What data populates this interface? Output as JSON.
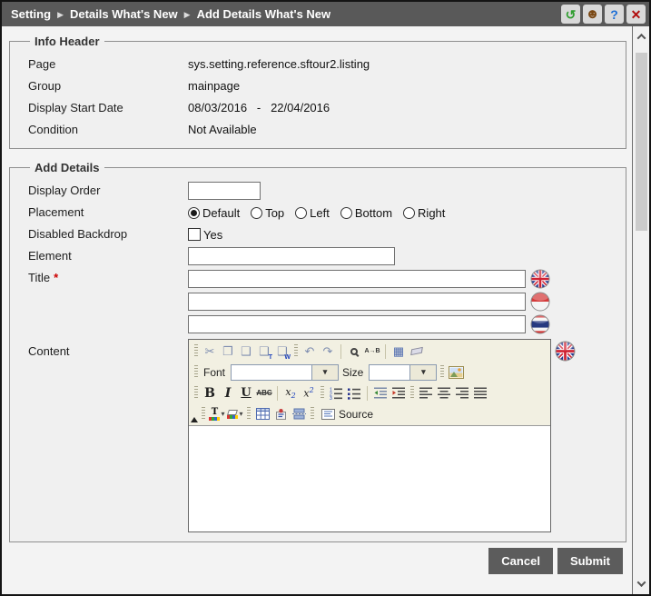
{
  "breadcrumb": {
    "items": [
      "Setting",
      "Details What's New",
      "Add Details What's New"
    ],
    "separator": "▶"
  },
  "titlebar_icons": {
    "refresh_glyph": "↺",
    "session_glyph": "☻",
    "help_glyph": "?",
    "close_glyph": "✕"
  },
  "info_header": {
    "legend": "Info Header",
    "fields": [
      {
        "label": "Page",
        "value": "sys.setting.reference.sftour2.listing"
      },
      {
        "label": "Group",
        "value": "mainpage"
      },
      {
        "label": "Display Start Date",
        "value": "08/03/2016   -   22/04/2016"
      },
      {
        "label": "Condition",
        "value": "Not Available"
      }
    ]
  },
  "add_details": {
    "legend": "Add Details",
    "display_order": {
      "label": "Display Order",
      "value": ""
    },
    "placement": {
      "label": "Placement",
      "options": [
        {
          "label": "Default",
          "selected": true
        },
        {
          "label": "Top",
          "selected": false
        },
        {
          "label": "Left",
          "selected": false
        },
        {
          "label": "Bottom",
          "selected": false
        },
        {
          "label": "Right",
          "selected": false
        }
      ]
    },
    "disabled_backdrop": {
      "label": "Disabled Backdrop",
      "option_label": "Yes",
      "checked": false
    },
    "element": {
      "label": "Element",
      "value": ""
    },
    "title": {
      "label": "Title",
      "required_marker": "*",
      "inputs": [
        {
          "language": "english",
          "flag": "uk",
          "value": ""
        },
        {
          "language": "indonesian",
          "flag": "indonesia",
          "value": ""
        },
        {
          "language": "thai",
          "flag": "thailand",
          "value": ""
        }
      ]
    },
    "content": {
      "label": "Content",
      "language": "english",
      "editor": {
        "font_label": "Font",
        "font_value": "",
        "size_label": "Size",
        "size_value": "",
        "source_label": "Source",
        "body_text": "",
        "toolbar_icons_row1": [
          "cut",
          "copy",
          "paste",
          "paste-plain-text",
          "paste-from-word",
          "undo",
          "redo",
          "find",
          "replace",
          "select-all",
          "remove-format"
        ],
        "toolbar_icons_row2": [
          "font-dropdown",
          "size-dropdown",
          "insert-image"
        ],
        "toolbar_icons_row3": [
          "bold",
          "italic",
          "underline",
          "strikethrough",
          "subscript",
          "superscript",
          "numbered-list",
          "bulleted-list",
          "decrease-indent",
          "increase-indent",
          "align-left",
          "align-center",
          "align-right",
          "align-justify"
        ],
        "toolbar_icons_row4": [
          "text-color",
          "background-color",
          "insert-table",
          "insert-special",
          "page-break",
          "source"
        ]
      }
    }
  },
  "footer": {
    "cancel_label": "Cancel",
    "submit_label": "Submit"
  }
}
